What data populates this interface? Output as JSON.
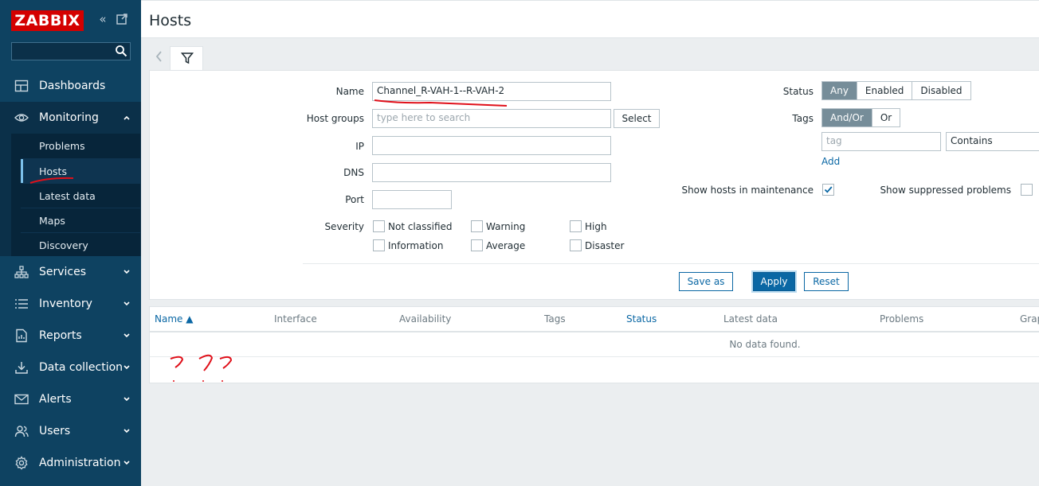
{
  "app": {
    "logo": "ZABBIX"
  },
  "sidebar": {
    "menu": [
      {
        "label": "Dashboards",
        "icon": "dashboard-icon"
      },
      {
        "label": "Monitoring",
        "icon": "eye-icon"
      },
      {
        "label": "Services",
        "icon": "services-icon"
      },
      {
        "label": "Inventory",
        "icon": "list-icon"
      },
      {
        "label": "Reports",
        "icon": "report-icon"
      },
      {
        "label": "Data collection",
        "icon": "download-icon"
      },
      {
        "label": "Alerts",
        "icon": "envelope-icon"
      },
      {
        "label": "Users",
        "icon": "users-icon"
      },
      {
        "label": "Administration",
        "icon": "gear-icon"
      }
    ],
    "monitoring_sub": [
      "Problems",
      "Hosts",
      "Latest data",
      "Maps",
      "Discovery"
    ]
  },
  "header": {
    "title": "Hosts"
  },
  "filter": {
    "name_label": "Name",
    "name_value": "Channel_R-VAH-1--R-VAH-2",
    "host_groups_label": "Host groups",
    "host_groups_placeholder": "type here to search",
    "select_label": "Select",
    "ip_label": "IP",
    "dns_label": "DNS",
    "port_label": "Port",
    "severity_label": "Severity",
    "severities": [
      "Not classified",
      "Warning",
      "High",
      "Information",
      "Average",
      "Disaster"
    ],
    "status_label": "Status",
    "status_options": [
      "Any",
      "Enabled",
      "Disabled"
    ],
    "tags_label": "Tags",
    "tags_options": [
      "And/Or",
      "Or"
    ],
    "tag_placeholder": "tag",
    "tag_operator": "Contains",
    "add_label": "Add",
    "maintenance_label": "Show hosts in maintenance",
    "suppressed_label": "Show suppressed problems",
    "save_as": "Save as",
    "apply": "Apply",
    "reset": "Reset"
  },
  "table": {
    "columns": [
      "Name ▲",
      "Interface",
      "Availability",
      "Tags",
      "Status",
      "Latest data",
      "Problems",
      "Grap"
    ],
    "empty": "No data found."
  },
  "colors": {
    "sidebar": "#0e4261",
    "logo": "#d40000",
    "accent": "#0a67a4"
  }
}
